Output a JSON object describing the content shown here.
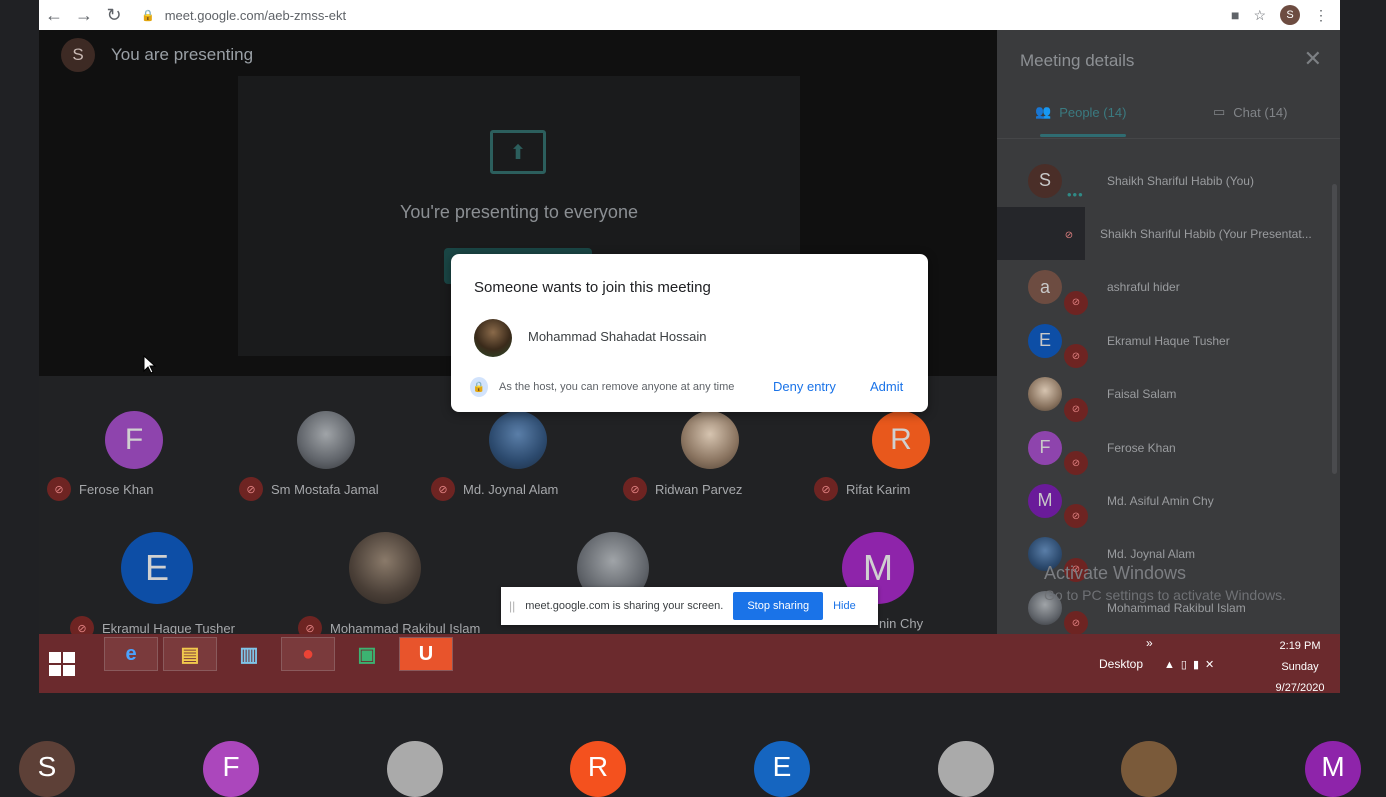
{
  "browser": {
    "url": "meet.google.com/aeb-zmss-ekt",
    "profile_initial": "S"
  },
  "stage": {
    "presenter_initial": "S",
    "presenting_label": "You are presenting",
    "presenting_to_everyone": "You're presenting to everyone"
  },
  "tiles": [
    {
      "initial": "F",
      "name": "Ferose Khan",
      "color": "#8e44ad"
    },
    {
      "initial": "",
      "name": "Sm Mostafa Jamal",
      "color": "#555"
    },
    {
      "initial": "",
      "name": "Md. Joynal Alam",
      "color": "#2c4a6e"
    },
    {
      "initial": "",
      "name": "Ridwan Parvez",
      "color": "#4a3c30"
    },
    {
      "initial": "R",
      "name": "Rifat Karim",
      "color": "#e8581c"
    },
    {
      "initial": "E",
      "name": "Ekramul Haque Tusher",
      "color": "#0d4ea6"
    },
    {
      "initial": "",
      "name": "Mohammad Rakibul Islam",
      "color": "#555"
    },
    {
      "initial": "",
      "name": "",
      "color": "#555"
    },
    {
      "initial": "M",
      "name": "nin Chy",
      "color": "#8e24aa"
    }
  ],
  "panel": {
    "title": "Meeting details",
    "tab_people": "People (14)",
    "tab_chat": "Chat (14)",
    "people": [
      {
        "initial": "S",
        "name": "Shaikh Shariful Habib (You)",
        "color": "#4a2e28"
      },
      {
        "initial": "",
        "name": "Shaikh Shariful Habib (Your Presentat...",
        "color": "#25262a"
      },
      {
        "initial": "a",
        "name": "ashraful hider",
        "color": "#6d4c41"
      },
      {
        "initial": "E",
        "name": "Ekramul Haque Tusher",
        "color": "#0d4ea6"
      },
      {
        "initial": "",
        "name": "Faisal Salam",
        "color": "#888"
      },
      {
        "initial": "F",
        "name": "Ferose Khan",
        "color": "#8e44ad"
      },
      {
        "initial": "M",
        "name": "Md. Asiful Amin Chy",
        "color": "#6a1b9a"
      },
      {
        "initial": "",
        "name": "Md. Joynal Alam",
        "color": "#2c4a6e"
      },
      {
        "initial": "",
        "name": "Mohammad Rakibul Islam",
        "color": "#555"
      }
    ],
    "watermark_line1": "Activate Windows",
    "watermark_line2": "Go to PC settings to activate Windows."
  },
  "dialog": {
    "title": "Someone wants to join this meeting",
    "requester_name": "Mohammad Shahadat Hossain",
    "host_note": "As the host, you can remove anyone at any time",
    "deny_label": "Deny entry",
    "admit_label": "Admit"
  },
  "sharebar": {
    "message": "meet.google.com is sharing your screen.",
    "stop_label": "Stop sharing",
    "hide_label": "Hide"
  },
  "taskbar": {
    "desktop_label": "Desktop",
    "time": "2:19 PM",
    "day": "Sunday",
    "date": "9/27/2020"
  },
  "bottom_strip": [
    {
      "initial": "S",
      "color": "#5d4037"
    },
    {
      "initial": "F",
      "color": "#ab47bc"
    },
    {
      "initial": "",
      "color": "#aaa"
    },
    {
      "initial": "R",
      "color": "#f4511e"
    },
    {
      "initial": "E",
      "color": "#1565c0"
    },
    {
      "initial": "",
      "color": "#aaa"
    },
    {
      "initial": "",
      "color": "#7a5a3a"
    },
    {
      "initial": "M",
      "color": "#8e24aa"
    }
  ],
  "colors": {
    "accent_blue": "#1a73e8",
    "meet_teal": "#2f6c72",
    "mic_off_red": "#6e2422",
    "taskbar": "#6b2a2d"
  }
}
